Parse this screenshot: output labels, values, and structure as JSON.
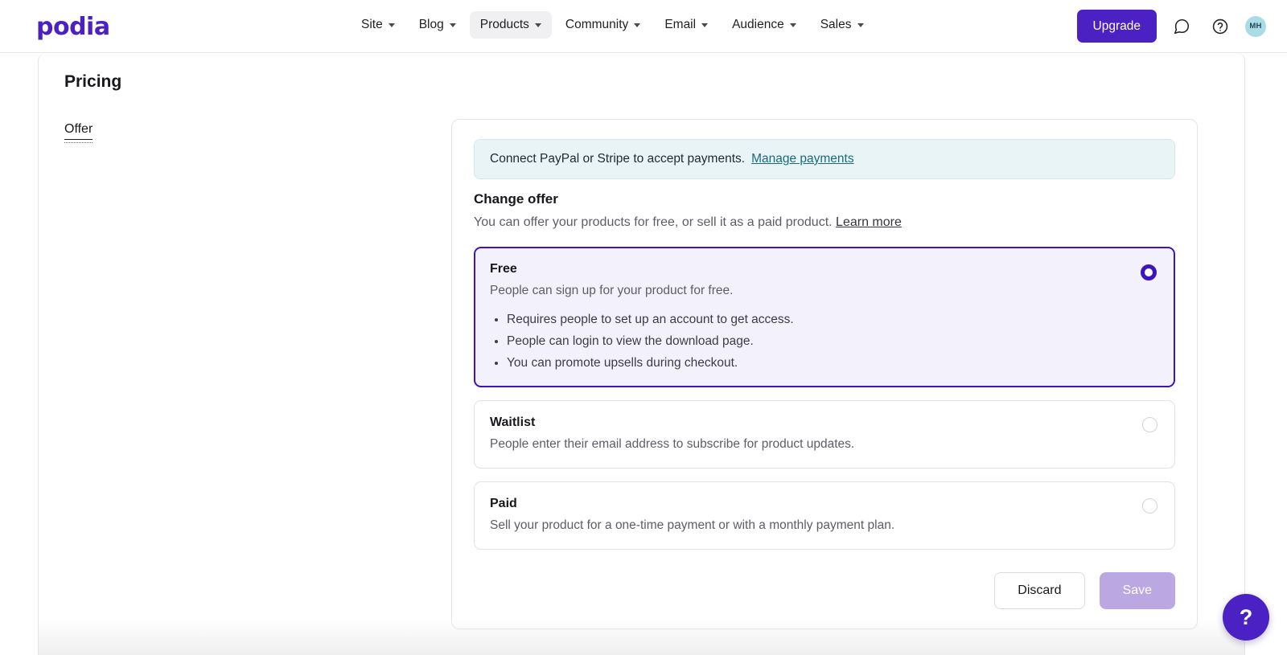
{
  "brand": {
    "logo_text": "podia",
    "accent": "#4b21c4"
  },
  "topnav": {
    "items": [
      {
        "label": "Site",
        "icon": "chevron-down-icon",
        "active": false
      },
      {
        "label": "Blog",
        "icon": "chevron-down-icon",
        "active": false
      },
      {
        "label": "Products",
        "icon": "chevron-down-icon",
        "active": true
      },
      {
        "label": "Community",
        "icon": "chevron-down-icon",
        "active": false
      },
      {
        "label": "Email",
        "icon": "chevron-down-icon",
        "active": false
      },
      {
        "label": "Audience",
        "icon": "chevron-down-icon",
        "active": false
      },
      {
        "label": "Sales",
        "icon": "chevron-down-icon",
        "active": false
      }
    ],
    "upgrade_label": "Upgrade",
    "chat_icon": "chat-bubble-icon",
    "help_icon": "question-circle-icon",
    "avatar_initials": "MH"
  },
  "page": {
    "title": "Pricing",
    "tabs": [
      {
        "label": "Offer",
        "active": true
      }
    ]
  },
  "banner": {
    "text": "Connect PayPal or Stripe to accept payments.",
    "link_label": "Manage payments",
    "bg": "#e9f4f6",
    "link_color": "#1b6a7c"
  },
  "section": {
    "title": "Change offer",
    "subtitle": "You can offer your products for free, or sell it as a paid product.",
    "learn_more_label": "Learn more"
  },
  "offer_options": [
    {
      "name": "Free",
      "description": "People can sign up for your product for free.",
      "selected": true,
      "bullets": [
        "Requires people to set up an account to get access.",
        "People can login to view the download page.",
        "You can promote upsells during checkout."
      ]
    },
    {
      "name": "Waitlist",
      "description": "People enter their email address to subscribe for product updates.",
      "selected": false,
      "bullets": []
    },
    {
      "name": "Paid",
      "description": "Sell your product for a one-time payment or with a monthly payment plan.",
      "selected": false,
      "bullets": []
    }
  ],
  "footer": {
    "discard_label": "Discard",
    "save_label": "Save",
    "save_disabled": true
  },
  "help_fab": {
    "glyph": "?",
    "name": "help-icon",
    "color": "#4b21c4"
  }
}
